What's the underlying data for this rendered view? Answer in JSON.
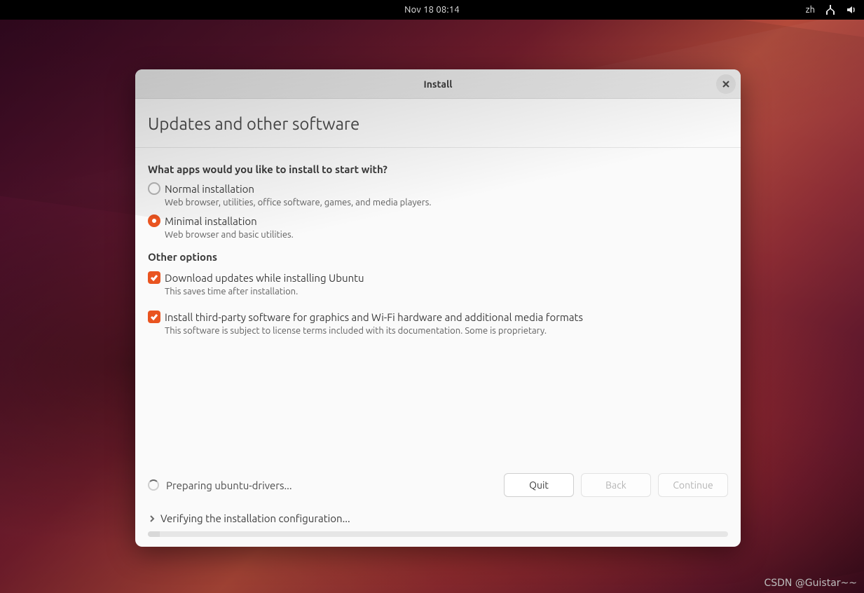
{
  "topbar": {
    "datetime": "Nov 18  08:14",
    "ime": "zh"
  },
  "window": {
    "title": "Install"
  },
  "page": {
    "heading": "Updates and other software",
    "question": "What apps would you like to install to start with?",
    "options": {
      "normal": {
        "label": "Normal installation",
        "desc": "Web browser, utilities, office software, games, and media players.",
        "selected": false
      },
      "minimal": {
        "label": "Minimal installation",
        "desc": "Web browser and basic utilities.",
        "selected": true
      }
    },
    "other_label": "Other options",
    "checks": {
      "updates": {
        "label": "Download updates while installing Ubuntu",
        "desc": "This saves time after installation.",
        "checked": true
      },
      "thirdparty": {
        "label": "Install third-party software for graphics and Wi-Fi hardware and additional media formats",
        "desc": "This software is subject to license terms included with its documentation. Some is proprietary.",
        "checked": true
      }
    },
    "status": "Preparing ubuntu-drivers...",
    "buttons": {
      "quit": "Quit",
      "back": "Back",
      "continue": "Continue"
    },
    "expand": "Verifying the installation configuration..."
  },
  "watermark": "CSDN @Guistar~~"
}
